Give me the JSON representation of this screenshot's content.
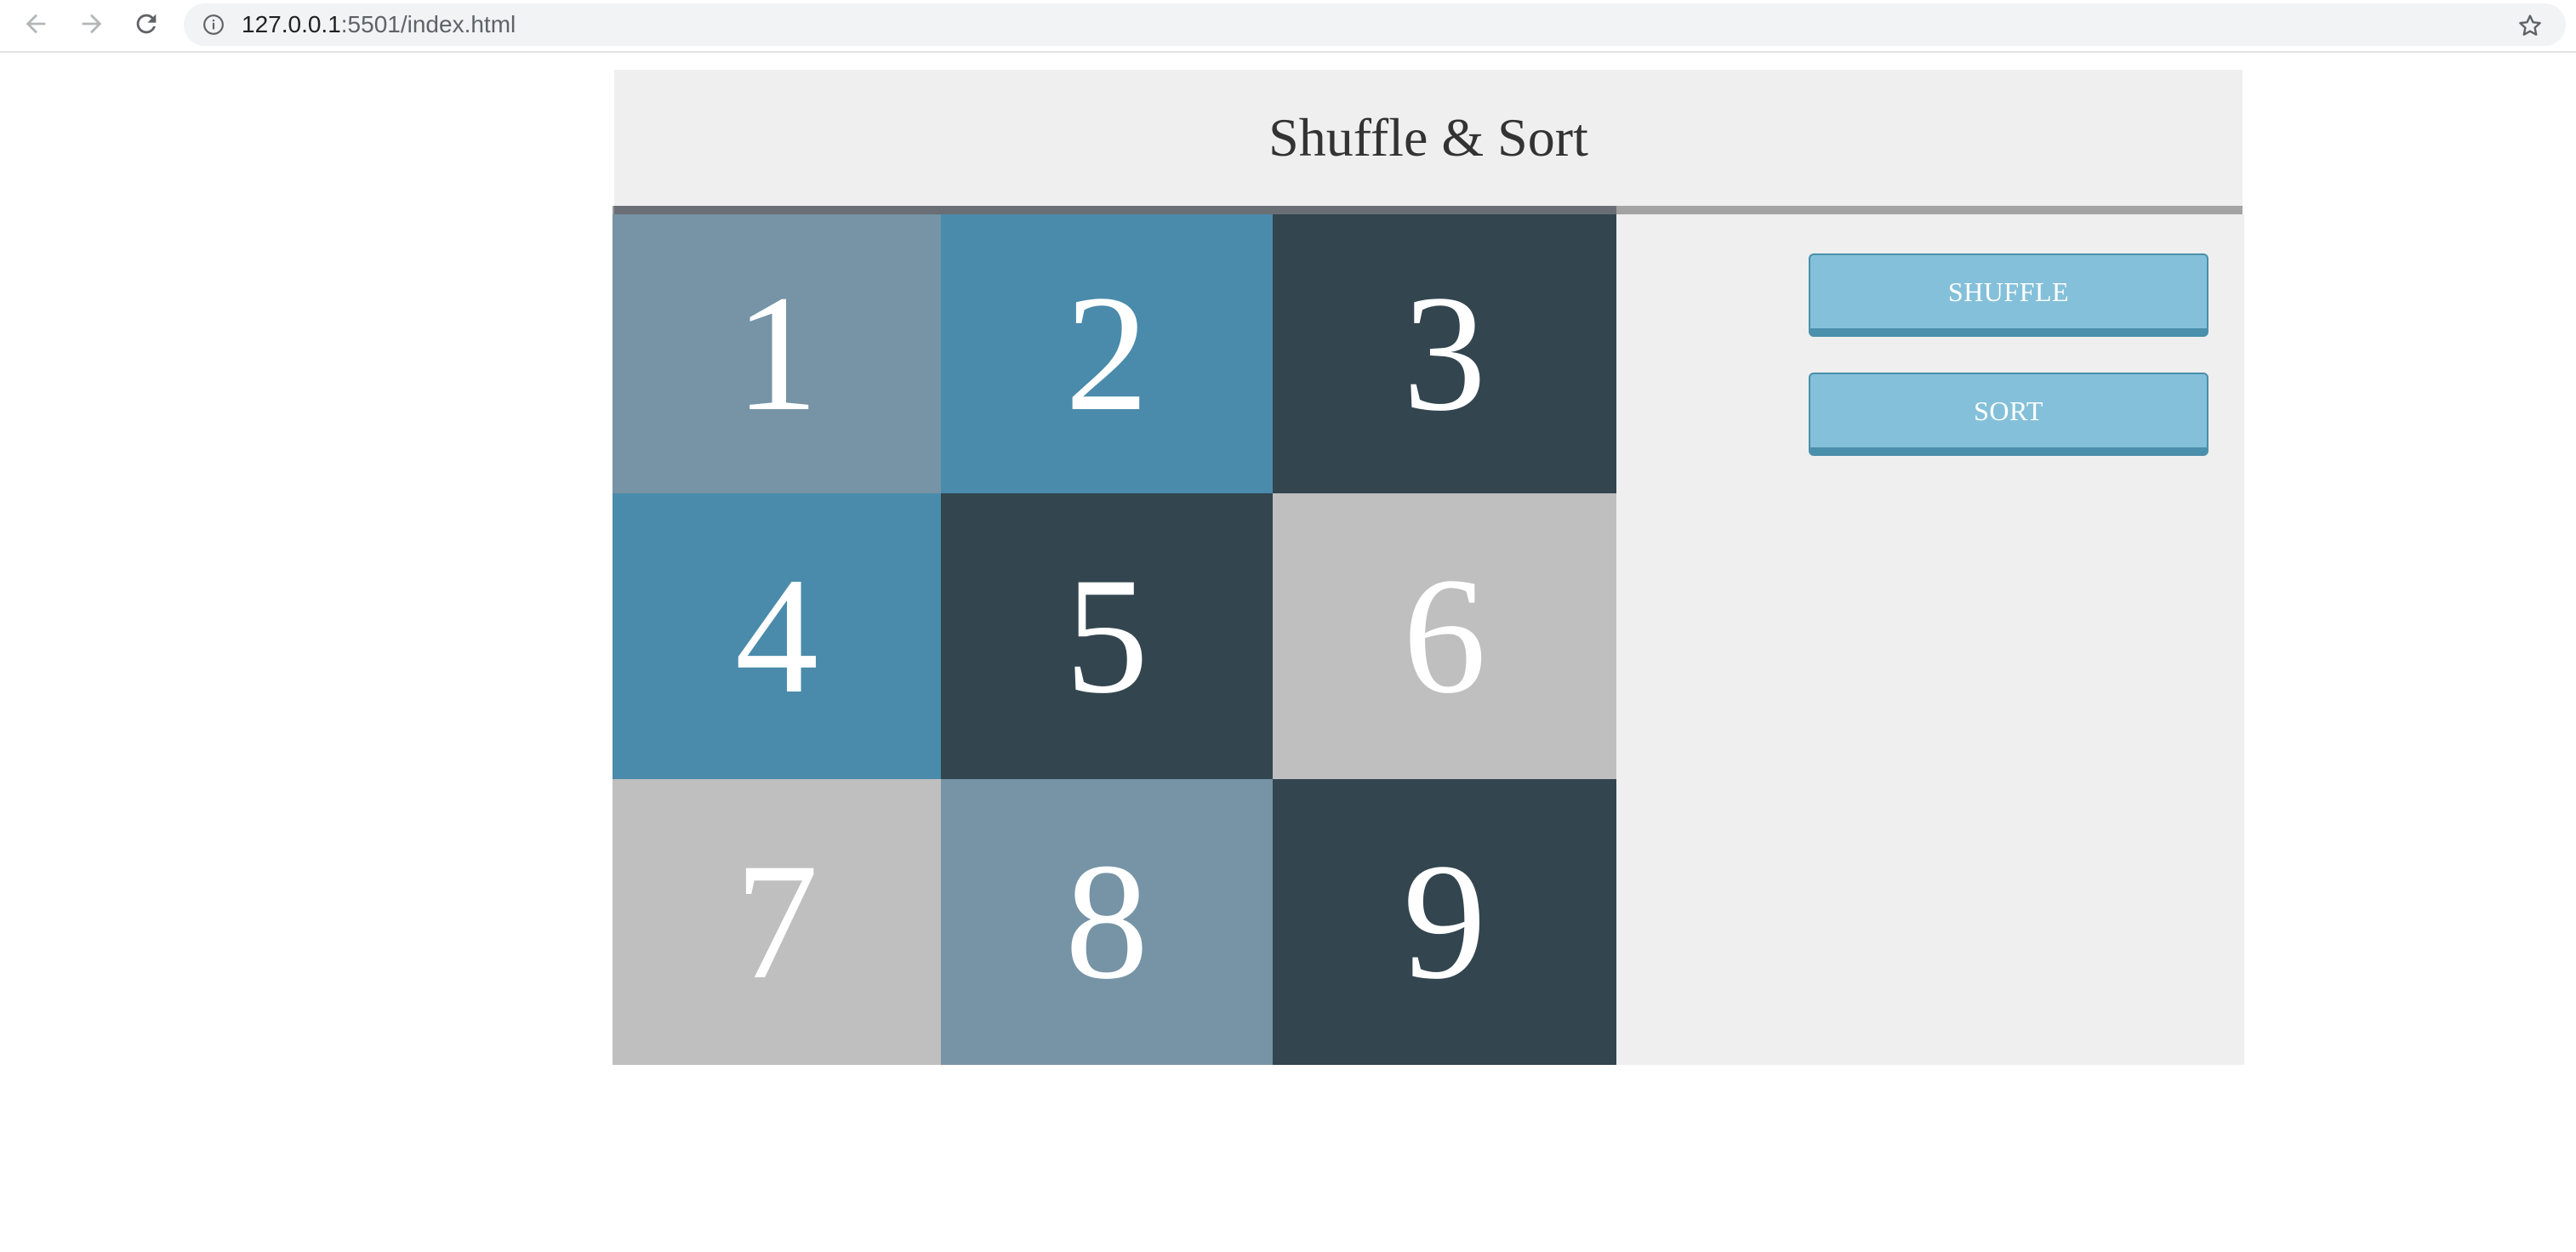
{
  "browser": {
    "url_host": "127.0.0.1",
    "url_rest": ":5501/index.html"
  },
  "page": {
    "title": "Shuffle & Sort"
  },
  "controls": {
    "shuffle_label": "SHUFFLE",
    "sort_label": "SORT"
  },
  "tiles": [
    {
      "label": "1",
      "color": "#7694a6"
    },
    {
      "label": "2",
      "color": "#4a8bab"
    },
    {
      "label": "3",
      "color": "#33454f"
    },
    {
      "label": "4",
      "color": "#4a8bab"
    },
    {
      "label": "5",
      "color": "#33454f"
    },
    {
      "label": "6",
      "color": "#bfbfbf"
    },
    {
      "label": "7",
      "color": "#bfbfbf"
    },
    {
      "label": "8",
      "color": "#7694a6"
    },
    {
      "label": "9",
      "color": "#33454f"
    }
  ]
}
